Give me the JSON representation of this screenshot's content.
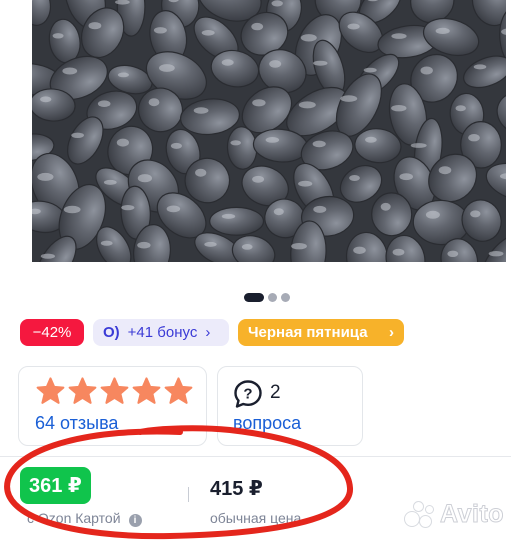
{
  "gallery": {
    "dots_count": 3,
    "active_index": 0
  },
  "badges": {
    "discount": "−42%",
    "bonus": "+41 бонус",
    "black_friday": "Черная пятница",
    "chevron": "›"
  },
  "rating": {
    "stars": 5,
    "reviews_label": "64 отзыва"
  },
  "questions": {
    "count": "2",
    "label": "вопроса"
  },
  "price": {
    "card_price": "361 ₽",
    "card_label": "с Ozon Картой",
    "info_glyph": "i",
    "regular_price": "415 ₽",
    "regular_label": "обычная цена"
  },
  "watermark": {
    "text": "Avito"
  },
  "colors": {
    "discount": "#f5183f",
    "bonus_bg": "#ecebfa",
    "bonus_text": "#3b3bd6",
    "friday": "#f7b22a",
    "star": "#f7875f",
    "link": "#1a5fd6",
    "card_price": "#10c44c",
    "annotation_circle": "#e4261c"
  }
}
